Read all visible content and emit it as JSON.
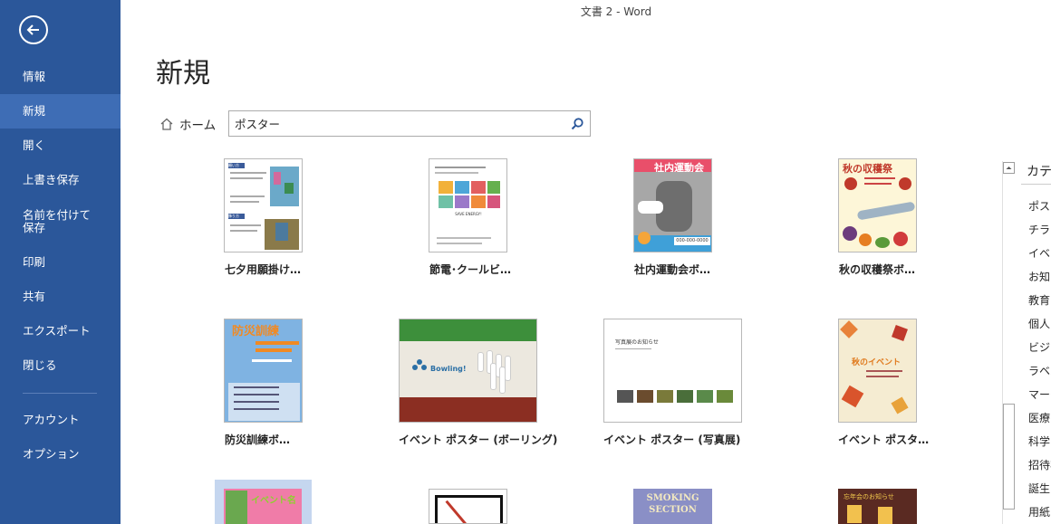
{
  "window": {
    "title": "文書 2 - Word"
  },
  "sidebar": {
    "back_icon": "back-arrow-icon",
    "items": [
      {
        "label": "情報"
      },
      {
        "label": "新規"
      },
      {
        "label": "開く"
      },
      {
        "label": "上書き保存"
      },
      {
        "label": "名前を付けて\n保存"
      },
      {
        "label": "印刷"
      },
      {
        "label": "共有"
      },
      {
        "label": "エクスポート"
      },
      {
        "label": "閉じる"
      },
      {
        "label": "アカウント"
      },
      {
        "label": "オプション"
      }
    ],
    "active_index": 1,
    "background": "#2b579a",
    "active_background": "#3e6db5"
  },
  "main": {
    "page_title": "新規",
    "home_label": "ホーム",
    "search": {
      "value": "ポスター",
      "icon": "search-icon"
    },
    "templates": [
      {
        "label": "七夕用願掛け…"
      },
      {
        "label": "節電･クールビ…"
      },
      {
        "label": "社内運動会ボ…"
      },
      {
        "label": "秋の収穫祭ボ…"
      },
      {
        "label": "防災訓練ボ…"
      },
      {
        "label": "イベント ポスター (ボーリング)"
      },
      {
        "label": "イベント ポスター (写真展)"
      },
      {
        "label": "イベント ポスタ…"
      }
    ],
    "thumb_text": {
      "sports_day": "社内運動会",
      "sports_phone": "000-000-0000",
      "harvest": "秋の収穫祭",
      "disaster": "防災訓練",
      "bowling": "Bowling!",
      "photo_title": "写真展のお知らせ",
      "autumn_event": "秋のイベント",
      "event_name": "イベント名",
      "smoking": "SMOKING SECTION",
      "newyear": "忘年会のお知らせ",
      "tanabata_1": "願い方",
      "tanabata_2": "飾り方",
      "setsuden": "SAVE ENERGY!"
    }
  },
  "categories": {
    "header": "カテゴリ",
    "items": [
      "ポスター",
      "チラシ",
      "イベント",
      "お知らせ",
      "教育",
      "個人",
      "ビジネス",
      "ラベル",
      "マーケティング",
      "医療",
      "科学",
      "招待状",
      "誕生日",
      "用紙"
    ]
  }
}
